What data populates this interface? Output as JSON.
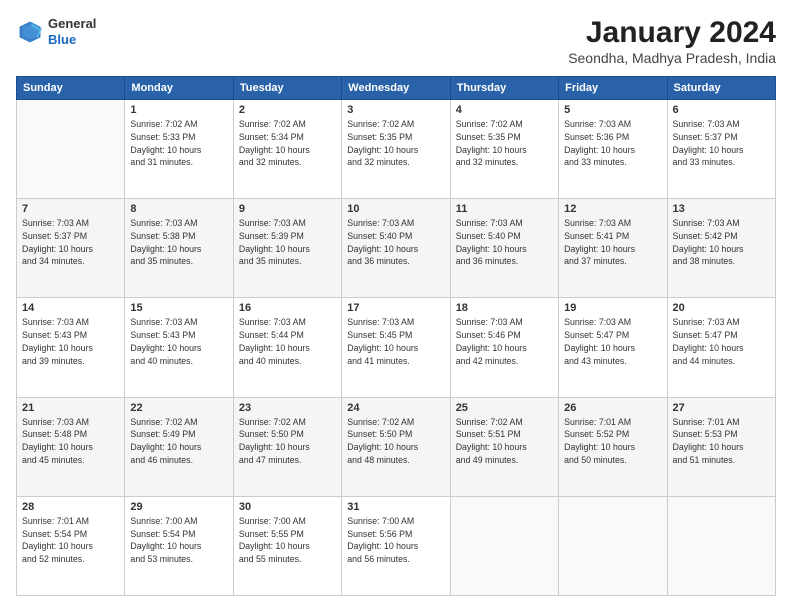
{
  "logo": {
    "general": "General",
    "blue": "Blue"
  },
  "header": {
    "month": "January 2024",
    "location": "Seondha, Madhya Pradesh, India"
  },
  "weekdays": [
    "Sunday",
    "Monday",
    "Tuesday",
    "Wednesday",
    "Thursday",
    "Friday",
    "Saturday"
  ],
  "weeks": [
    [
      {
        "day": "",
        "info": ""
      },
      {
        "day": "1",
        "info": "Sunrise: 7:02 AM\nSunset: 5:33 PM\nDaylight: 10 hours\nand 31 minutes."
      },
      {
        "day": "2",
        "info": "Sunrise: 7:02 AM\nSunset: 5:34 PM\nDaylight: 10 hours\nand 32 minutes."
      },
      {
        "day": "3",
        "info": "Sunrise: 7:02 AM\nSunset: 5:35 PM\nDaylight: 10 hours\nand 32 minutes."
      },
      {
        "day": "4",
        "info": "Sunrise: 7:02 AM\nSunset: 5:35 PM\nDaylight: 10 hours\nand 32 minutes."
      },
      {
        "day": "5",
        "info": "Sunrise: 7:03 AM\nSunset: 5:36 PM\nDaylight: 10 hours\nand 33 minutes."
      },
      {
        "day": "6",
        "info": "Sunrise: 7:03 AM\nSunset: 5:37 PM\nDaylight: 10 hours\nand 33 minutes."
      }
    ],
    [
      {
        "day": "7",
        "info": "Sunrise: 7:03 AM\nSunset: 5:37 PM\nDaylight: 10 hours\nand 34 minutes."
      },
      {
        "day": "8",
        "info": "Sunrise: 7:03 AM\nSunset: 5:38 PM\nDaylight: 10 hours\nand 35 minutes."
      },
      {
        "day": "9",
        "info": "Sunrise: 7:03 AM\nSunset: 5:39 PM\nDaylight: 10 hours\nand 35 minutes."
      },
      {
        "day": "10",
        "info": "Sunrise: 7:03 AM\nSunset: 5:40 PM\nDaylight: 10 hours\nand 36 minutes."
      },
      {
        "day": "11",
        "info": "Sunrise: 7:03 AM\nSunset: 5:40 PM\nDaylight: 10 hours\nand 36 minutes."
      },
      {
        "day": "12",
        "info": "Sunrise: 7:03 AM\nSunset: 5:41 PM\nDaylight: 10 hours\nand 37 minutes."
      },
      {
        "day": "13",
        "info": "Sunrise: 7:03 AM\nSunset: 5:42 PM\nDaylight: 10 hours\nand 38 minutes."
      }
    ],
    [
      {
        "day": "14",
        "info": "Sunrise: 7:03 AM\nSunset: 5:43 PM\nDaylight: 10 hours\nand 39 minutes."
      },
      {
        "day": "15",
        "info": "Sunrise: 7:03 AM\nSunset: 5:43 PM\nDaylight: 10 hours\nand 40 minutes."
      },
      {
        "day": "16",
        "info": "Sunrise: 7:03 AM\nSunset: 5:44 PM\nDaylight: 10 hours\nand 40 minutes."
      },
      {
        "day": "17",
        "info": "Sunrise: 7:03 AM\nSunset: 5:45 PM\nDaylight: 10 hours\nand 41 minutes."
      },
      {
        "day": "18",
        "info": "Sunrise: 7:03 AM\nSunset: 5:46 PM\nDaylight: 10 hours\nand 42 minutes."
      },
      {
        "day": "19",
        "info": "Sunrise: 7:03 AM\nSunset: 5:47 PM\nDaylight: 10 hours\nand 43 minutes."
      },
      {
        "day": "20",
        "info": "Sunrise: 7:03 AM\nSunset: 5:47 PM\nDaylight: 10 hours\nand 44 minutes."
      }
    ],
    [
      {
        "day": "21",
        "info": "Sunrise: 7:03 AM\nSunset: 5:48 PM\nDaylight: 10 hours\nand 45 minutes."
      },
      {
        "day": "22",
        "info": "Sunrise: 7:02 AM\nSunset: 5:49 PM\nDaylight: 10 hours\nand 46 minutes."
      },
      {
        "day": "23",
        "info": "Sunrise: 7:02 AM\nSunset: 5:50 PM\nDaylight: 10 hours\nand 47 minutes."
      },
      {
        "day": "24",
        "info": "Sunrise: 7:02 AM\nSunset: 5:50 PM\nDaylight: 10 hours\nand 48 minutes."
      },
      {
        "day": "25",
        "info": "Sunrise: 7:02 AM\nSunset: 5:51 PM\nDaylight: 10 hours\nand 49 minutes."
      },
      {
        "day": "26",
        "info": "Sunrise: 7:01 AM\nSunset: 5:52 PM\nDaylight: 10 hours\nand 50 minutes."
      },
      {
        "day": "27",
        "info": "Sunrise: 7:01 AM\nSunset: 5:53 PM\nDaylight: 10 hours\nand 51 minutes."
      }
    ],
    [
      {
        "day": "28",
        "info": "Sunrise: 7:01 AM\nSunset: 5:54 PM\nDaylight: 10 hours\nand 52 minutes."
      },
      {
        "day": "29",
        "info": "Sunrise: 7:00 AM\nSunset: 5:54 PM\nDaylight: 10 hours\nand 53 minutes."
      },
      {
        "day": "30",
        "info": "Sunrise: 7:00 AM\nSunset: 5:55 PM\nDaylight: 10 hours\nand 55 minutes."
      },
      {
        "day": "31",
        "info": "Sunrise: 7:00 AM\nSunset: 5:56 PM\nDaylight: 10 hours\nand 56 minutes."
      },
      {
        "day": "",
        "info": ""
      },
      {
        "day": "",
        "info": ""
      },
      {
        "day": "",
        "info": ""
      }
    ]
  ]
}
